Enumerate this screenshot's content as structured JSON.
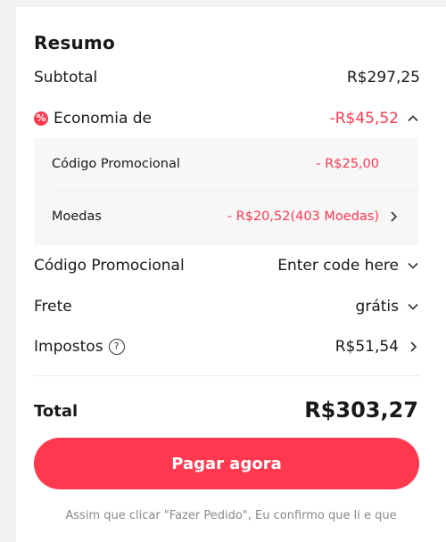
{
  "summary": {
    "title": "Resumo",
    "subtotal_label": "Subtotal",
    "subtotal_value": "R$297,25",
    "savings_label": "Economia de",
    "savings_value": "-R$45,52",
    "savings_icon": "discount-icon",
    "savings_details": {
      "promo_label": "Código Promocional",
      "promo_value": "- R$25,00",
      "coins_label": "Moedas",
      "coins_value": "- R$20,52(403 Moedas)"
    },
    "promo_code_label": "Código Promocional",
    "promo_code_value": "Enter code here",
    "shipping_label": "Frete",
    "shipping_value": "grátis",
    "taxes_label": "Impostos",
    "taxes_help": "?",
    "taxes_value": "R$51,54",
    "total_label": "Total",
    "total_value": "R$303,27",
    "pay_button": "Pagar agora",
    "disclaimer": "Assim que clicar \"Fazer Pedido\", Eu confirmo que li e que"
  },
  "colors": {
    "accent": "#fd384f",
    "background": "#f2f2f2",
    "card": "#ffffff",
    "details_bg": "#f7f7f7"
  }
}
